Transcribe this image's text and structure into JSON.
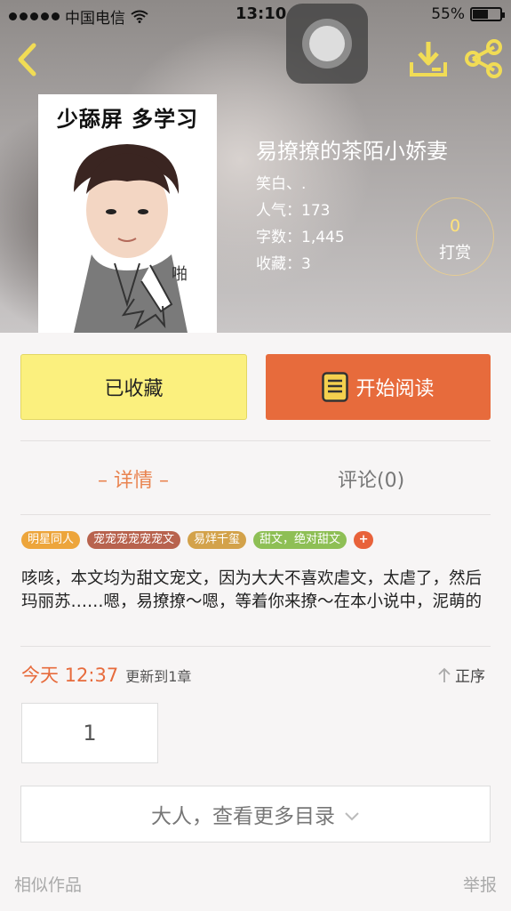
{
  "status_bar": {
    "carrier": "中国电信",
    "time": "13:10",
    "battery": "55%",
    "battery_level": 0.55
  },
  "book": {
    "cover_text": "少舔屏 多学习",
    "title": "易撩撩的茶陌小娇妻",
    "author": "笑白、.",
    "popularity": "人气：173",
    "word_count": "字数：1,445",
    "favorites": "收藏：3"
  },
  "tip": {
    "count": "0",
    "label": "打赏"
  },
  "actions": {
    "favorited_label": "已收藏",
    "read_label": "开始阅读"
  },
  "tabs": {
    "detail": "– 详情 –",
    "comments": "评论(0)"
  },
  "tags": [
    {
      "label": "明星同人",
      "color": "#eda53b"
    },
    {
      "label": "宠宠宠宠宠宠文",
      "color": "#b8634e"
    },
    {
      "label": "易烊千玺",
      "color": "#d3a24a"
    },
    {
      "label": "甜文，绝对甜文",
      "color": "#8ebf55"
    }
  ],
  "tag_more": "+",
  "tag_more_color": "#e8623a",
  "description": "咳咳，本文均为甜文宠文，因为大大不喜欢虐文，太虐了，然后玛丽苏……嗯，易撩撩～嗯，等着你来撩～在本小说中，泥萌的小肥童鞋及虎牙少年都有老婆～然后…",
  "update": {
    "time": "今天 12:37",
    "info": "更新到1章"
  },
  "order_label": "正序",
  "chapter": "1",
  "more_catalog": "大人，查看更多目录",
  "footer": {
    "similar": "相似作品",
    "report": "举报"
  },
  "colors": {
    "accent": "#e76b3c",
    "favorite_bg": "#fbf07e",
    "icon_yellow": "#f1dc55"
  },
  "icons": [
    "back-icon",
    "download-icon",
    "share-icon",
    "wifi-icon",
    "book-icon",
    "arrow-up-icon",
    "chevron-down-icon"
  ]
}
